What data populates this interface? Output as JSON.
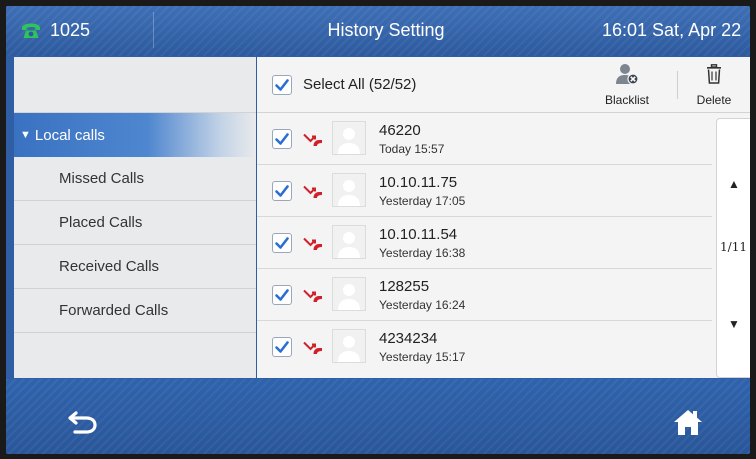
{
  "topbar": {
    "extension": "1025",
    "title": "History Setting",
    "datetime": "16:01 Sat, Apr 22"
  },
  "sidebar": {
    "group_label": "Local calls",
    "items": [
      {
        "label": "Missed Calls"
      },
      {
        "label": "Placed Calls"
      },
      {
        "label": "Received Calls"
      },
      {
        "label": "Forwarded Calls"
      }
    ]
  },
  "toolbar": {
    "select_all_label": "Select All (52/52)",
    "blacklist_label": "Blacklist",
    "delete_label": "Delete"
  },
  "calls": [
    {
      "number": "46220",
      "time": "Today 15:57",
      "checked": true
    },
    {
      "number": "10.10.11.75",
      "time": "Yesterday 17:05",
      "checked": true
    },
    {
      "number": "10.10.11.54",
      "time": "Yesterday 16:38",
      "checked": true
    },
    {
      "number": "128255",
      "time": "Yesterday 16:24",
      "checked": true
    },
    {
      "number": "4234234",
      "time": "Yesterday 15:17",
      "checked": true
    }
  ],
  "pager": {
    "page": "1/11"
  },
  "icons": {
    "phone": "phone-icon",
    "blacklist": "user-block-icon",
    "delete": "trash-icon",
    "missed_call": "missed-call-icon",
    "avatar": "contact-avatar-icon",
    "back": "back-arrow-icon",
    "home": "home-icon",
    "page_up": "up-arrow-icon",
    "page_down": "down-arrow-icon"
  },
  "colors": {
    "accent_blue": "#2f5ea4",
    "selected_item": "#3a72c2",
    "missed_call_red": "#d0202a",
    "checkbox_blue": "#2a6fd1",
    "phone_green": "#2fc45a"
  }
}
